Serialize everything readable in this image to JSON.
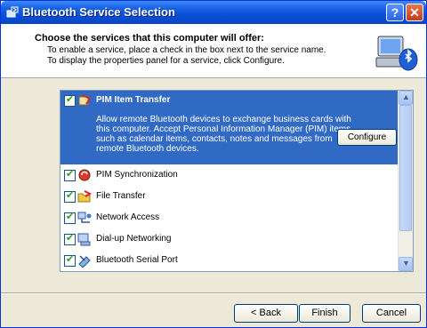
{
  "window": {
    "title": "Bluetooth Service Selection",
    "help_label": "?",
    "close_label": "✕"
  },
  "header": {
    "title": "Choose the services that this computer will offer:",
    "line1": "To enable a service, place a check in the box next to the service name.",
    "line2": "To display the properties panel for a service, click Configure."
  },
  "services": {
    "selected": {
      "label": "PIM Item Transfer",
      "checked": true,
      "icon": "pim-transfer-icon",
      "description": "Allow remote Bluetooth devices to exchange business cards with this computer. Accept Personal Information Manager (PIM) items such as calendar items, contacts, notes and messages from remote Bluetooth devices.",
      "configure_label": "Configure"
    },
    "items": [
      {
        "label": "PIM Synchronization",
        "checked": true,
        "icon": "pim-sync-icon"
      },
      {
        "label": "File Transfer",
        "checked": true,
        "icon": "file-transfer-icon"
      },
      {
        "label": "Network Access",
        "checked": true,
        "icon": "network-access-icon"
      },
      {
        "label": "Dial-up Networking",
        "checked": true,
        "icon": "dialup-icon"
      },
      {
        "label": "Bluetooth Serial Port",
        "checked": true,
        "icon": "serial-port-icon"
      }
    ]
  },
  "buttons": {
    "back": "< Back",
    "finish": "Finish",
    "cancel": "Cancel"
  },
  "colors": {
    "titlebar": "#0a4fd9",
    "selection": "#316ac5",
    "dialog": "#ece9d8"
  }
}
